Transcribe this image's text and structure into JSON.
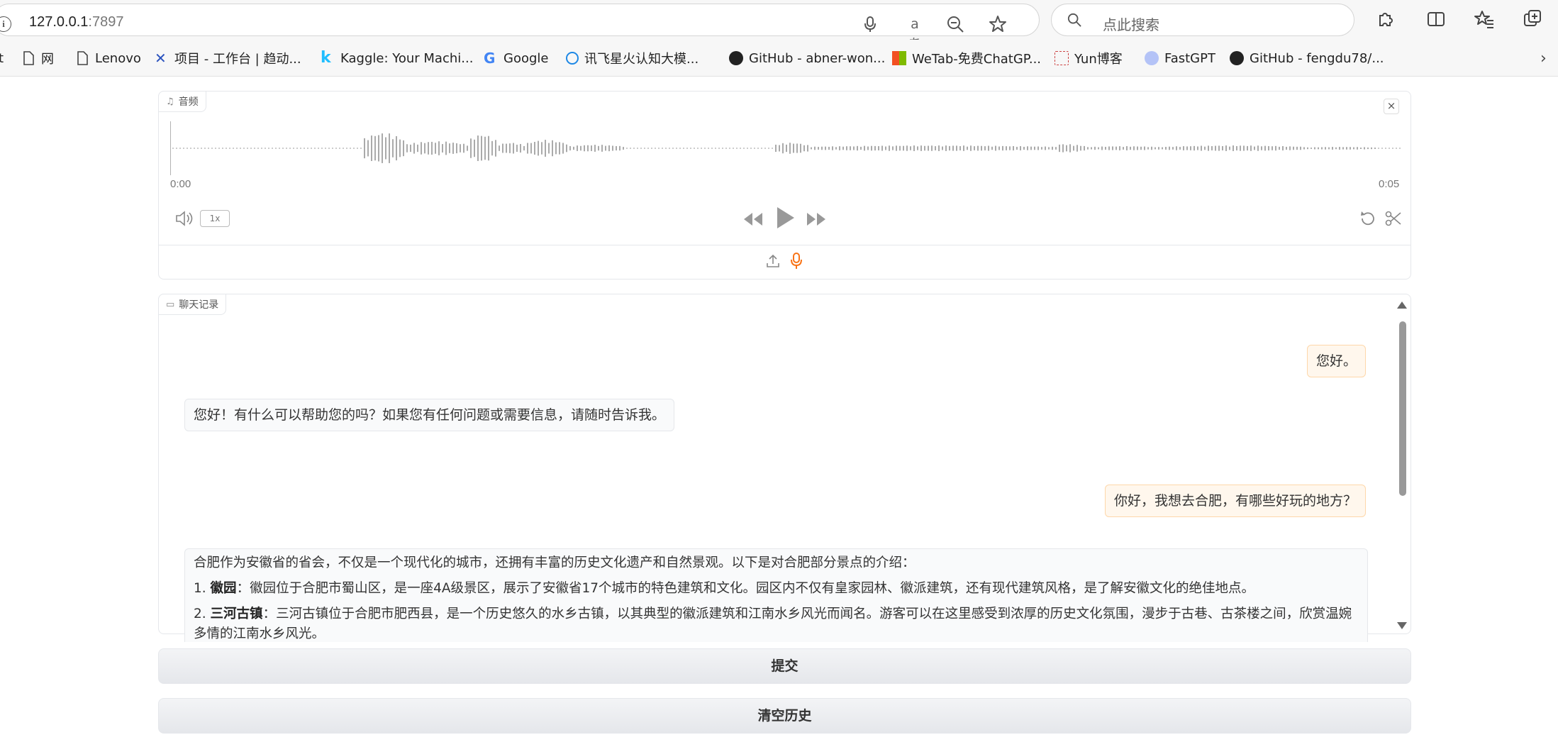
{
  "browser": {
    "url_host": "127.0.0.1",
    "url_port": ":7897",
    "search_placeholder": "点此搜索"
  },
  "bookmarks": [
    {
      "label": "t"
    },
    {
      "label": "网"
    },
    {
      "label": "Lenovo"
    },
    {
      "label": "项目 - 工作台 | 趋动..."
    },
    {
      "label": "Kaggle: Your Machi..."
    },
    {
      "label": "Google"
    },
    {
      "label": "讯飞星火认知大模..."
    },
    {
      "label": "GitHub - abner-won..."
    },
    {
      "label": "WeTab-免费ChatGP..."
    },
    {
      "label": "Yun博客"
    },
    {
      "label": "FastGPT"
    },
    {
      "label": "GitHub - fengdu78/..."
    }
  ],
  "audio": {
    "label": "音频",
    "time_start": "0:00",
    "time_end": "0:05",
    "speed": "1x"
  },
  "chat": {
    "label": "聊天记录",
    "messages": [
      {
        "role": "user",
        "text": "您好。"
      },
      {
        "role": "bot",
        "text": "您好！有什么可以帮助您的吗？如果您有任何问题或需要信息，请随时告诉我。"
      },
      {
        "role": "user",
        "text": "你好，我想去合肥，有哪些好玩的地方？"
      },
      {
        "role": "bot",
        "intro": "合肥作为安徽省的省会，不仅是一个现代化的城市，还拥有丰富的历史文化遗产和自然景观。以下是对合肥部分景点的介绍：",
        "items": [
          {
            "num": "1.",
            "name": "徽园",
            "desc": "：徽园位于合肥市蜀山区，是一座4A级景区，展示了安徽省17个城市的特色建筑和文化。园区内不仅有皇家园林、徽派建筑，还有现代建筑风格，是了解安徽文化的绝佳地点。"
          },
          {
            "num": "2.",
            "name": "三河古镇",
            "desc": "：三河古镇位于合肥市肥西县，是一个历史悠久的水乡古镇，以其典型的徽派建筑和江南水乡风光而闻名。游客可以在这里感受到浓厚的历史文化氛围，漫步于古巷、古茶楼之间，欣赏温婉多情的江南水乡风光。"
          }
        ]
      }
    ]
  },
  "buttons": {
    "submit": "提交",
    "clear": "清空历史"
  },
  "colors": {
    "user_bubble": "#fff7ed",
    "user_border": "#fed7aa",
    "mic_accent": "#f97316"
  }
}
